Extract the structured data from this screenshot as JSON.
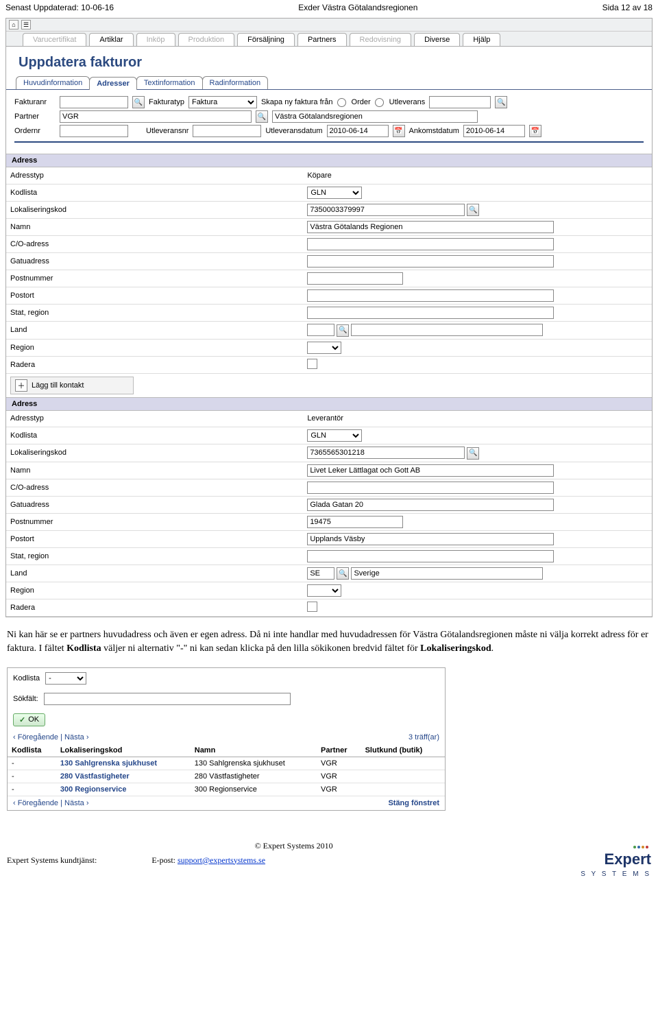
{
  "header": {
    "updated_label": "Senast Uppdaterad: 10-06-16",
    "center": "Exder Västra Götalandsregionen",
    "page": "Sida 12 av 18"
  },
  "main_tabs": [
    "Varucertifikat",
    "Artiklar",
    "Inköp",
    "Produktion",
    "Försäljning",
    "Partners",
    "Redovisning",
    "Diverse",
    "Hjälp"
  ],
  "main_tabs_disabled": [
    "Varucertifikat",
    "Inköp",
    "Produktion",
    "Redovisning"
  ],
  "page_title": "Uppdatera fakturor",
  "sub_tabs": [
    "Huvudinformation",
    "Adresser",
    "Textinformation",
    "Radinformation"
  ],
  "sub_tab_active": "Adresser",
  "form": {
    "fakturanr_lbl": "Fakturanr",
    "fakturanr_val": "",
    "fakturatyp_lbl": "Fakturatyp",
    "fakturatyp_val": "Faktura",
    "skapa_lbl": "Skapa ny faktura från",
    "skapa_opt1": "Order",
    "skapa_opt2": "Utleverans",
    "skapa_input": "",
    "partner_lbl": "Partner",
    "partner_val": "VGR",
    "partner_name": "Västra Götalandsregionen",
    "ordernr_lbl": "Ordernr",
    "ordernr_val": "",
    "utleveransnr_lbl": "Utleveransnr",
    "utleveransnr_val": "",
    "utleveransdatum_lbl": "Utleveransdatum",
    "utleveransdatum_val": "2010-06-14",
    "ankomstdatum_lbl": "Ankomstdatum",
    "ankomstdatum_val": "2010-06-14"
  },
  "labels": {
    "adress": "Adress",
    "adresstyp": "Adresstyp",
    "kodlista": "Kodlista",
    "lokaliseringskod": "Lokaliseringskod",
    "namn": "Namn",
    "co": "C/O-adress",
    "gatu": "Gatuadress",
    "postnr": "Postnummer",
    "postort": "Postort",
    "stat": "Stat, region",
    "land": "Land",
    "region": "Region",
    "radera": "Radera",
    "lagg_kontakt": "Lägg till kontakt"
  },
  "buyer": {
    "adresstyp": "Köpare",
    "kodlista": "GLN",
    "lokaliseringskod": "7350003379997",
    "namn": "Västra Götalands Regionen",
    "co": "",
    "gatu": "",
    "postnr": "",
    "postort": "",
    "stat": "",
    "land_code": "",
    "land_name": "",
    "region": ""
  },
  "supplier": {
    "adresstyp": "Leverantör",
    "kodlista": "GLN",
    "lokaliseringskod": "7365565301218",
    "namn": "Livet Leker Lättlagat och Gott AB",
    "co": "",
    "gatu": "Glada Gatan 20",
    "postnr": "19475",
    "postort": "Upplands Väsby",
    "stat": "",
    "land_code": "SE",
    "land_name": "Sverige",
    "region": ""
  },
  "narrative": {
    "p1a": "Ni kan här se er partners huvudadress och även er egen adress. Då ni inte handlar med huvudadressen för Västra Götalandsregionen måste ni välja korrekt adress för er faktura. I fältet ",
    "p1b": "Kodlista",
    "p1c": " väljer ni alternativ \"-\" ni kan sedan klicka på den lilla sökikonen bredvid fältet för ",
    "p1d": "Lokaliseringskod",
    "p1e": "."
  },
  "popup": {
    "kodlista_lbl": "Kodlista",
    "kodlista_val": "-",
    "sokfalt_lbl": "Sökfält:",
    "sokfalt_val": "",
    "ok": "OK",
    "prev": "‹ Föregående",
    "next": "Nästa ›",
    "hits": "3 träff(ar)",
    "cols": [
      "Kodlista",
      "Lokaliseringskod",
      "Namn",
      "Partner",
      "Slutkund (butik)"
    ],
    "rows": [
      {
        "kod": "-",
        "lok": "130 Sahlgrenska sjukhuset",
        "namn": "130 Sahlgrenska sjukhuset",
        "partner": "VGR",
        "slut": ""
      },
      {
        "kod": "-",
        "lok": "280 Västfastigheter",
        "namn": "280 Västfastigheter",
        "partner": "VGR",
        "slut": ""
      },
      {
        "kod": "-",
        "lok": "300 Regionservice",
        "namn": "300 Regionservice",
        "partner": "VGR",
        "slut": ""
      }
    ],
    "close": "Stäng fönstret"
  },
  "footer": {
    "copy": "© Expert Systems 2010",
    "kund_lbl": "Expert Systems kundtjänst:",
    "epost_lbl": "E-post: ",
    "epost_link": "support@expertsystems.se",
    "logo1": "Expert",
    "logo2": "S Y S T E M S"
  }
}
